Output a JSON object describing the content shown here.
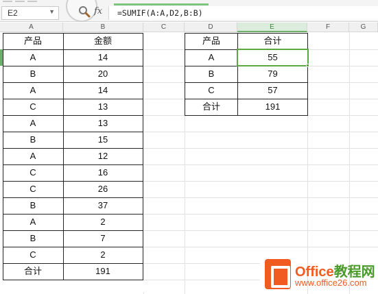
{
  "formula_bar": {
    "name_box": "E2",
    "fx_label": "fx",
    "formula": "=SUMIF(A:A,D2,B:B)"
  },
  "columns": [
    "A",
    "B",
    "C",
    "D",
    "E",
    "F",
    "G"
  ],
  "active_column": "E",
  "table_left": {
    "headers": [
      "产品",
      "金额"
    ],
    "rows": [
      [
        "A",
        "14"
      ],
      [
        "B",
        "20"
      ],
      [
        "A",
        "14"
      ],
      [
        "C",
        "13"
      ],
      [
        "A",
        "13"
      ],
      [
        "B",
        "15"
      ],
      [
        "A",
        "12"
      ],
      [
        "C",
        "16"
      ],
      [
        "C",
        "26"
      ],
      [
        "B",
        "37"
      ],
      [
        "A",
        "2"
      ],
      [
        "B",
        "7"
      ],
      [
        "C",
        "2"
      ],
      [
        "合计",
        "191"
      ]
    ]
  },
  "table_right": {
    "headers": [
      "产品",
      "合计"
    ],
    "rows": [
      [
        "A",
        "55"
      ],
      [
        "B",
        "79"
      ],
      [
        "C",
        "57"
      ],
      [
        "合计",
        "191"
      ]
    ]
  },
  "selected_cell": "E2",
  "watermark": {
    "brand": "Office",
    "brand_cn": "教程网",
    "url": "www.office26.com"
  },
  "colors": {
    "accent_green": "#5aa83f",
    "brand_orange": "#f25b1f"
  }
}
